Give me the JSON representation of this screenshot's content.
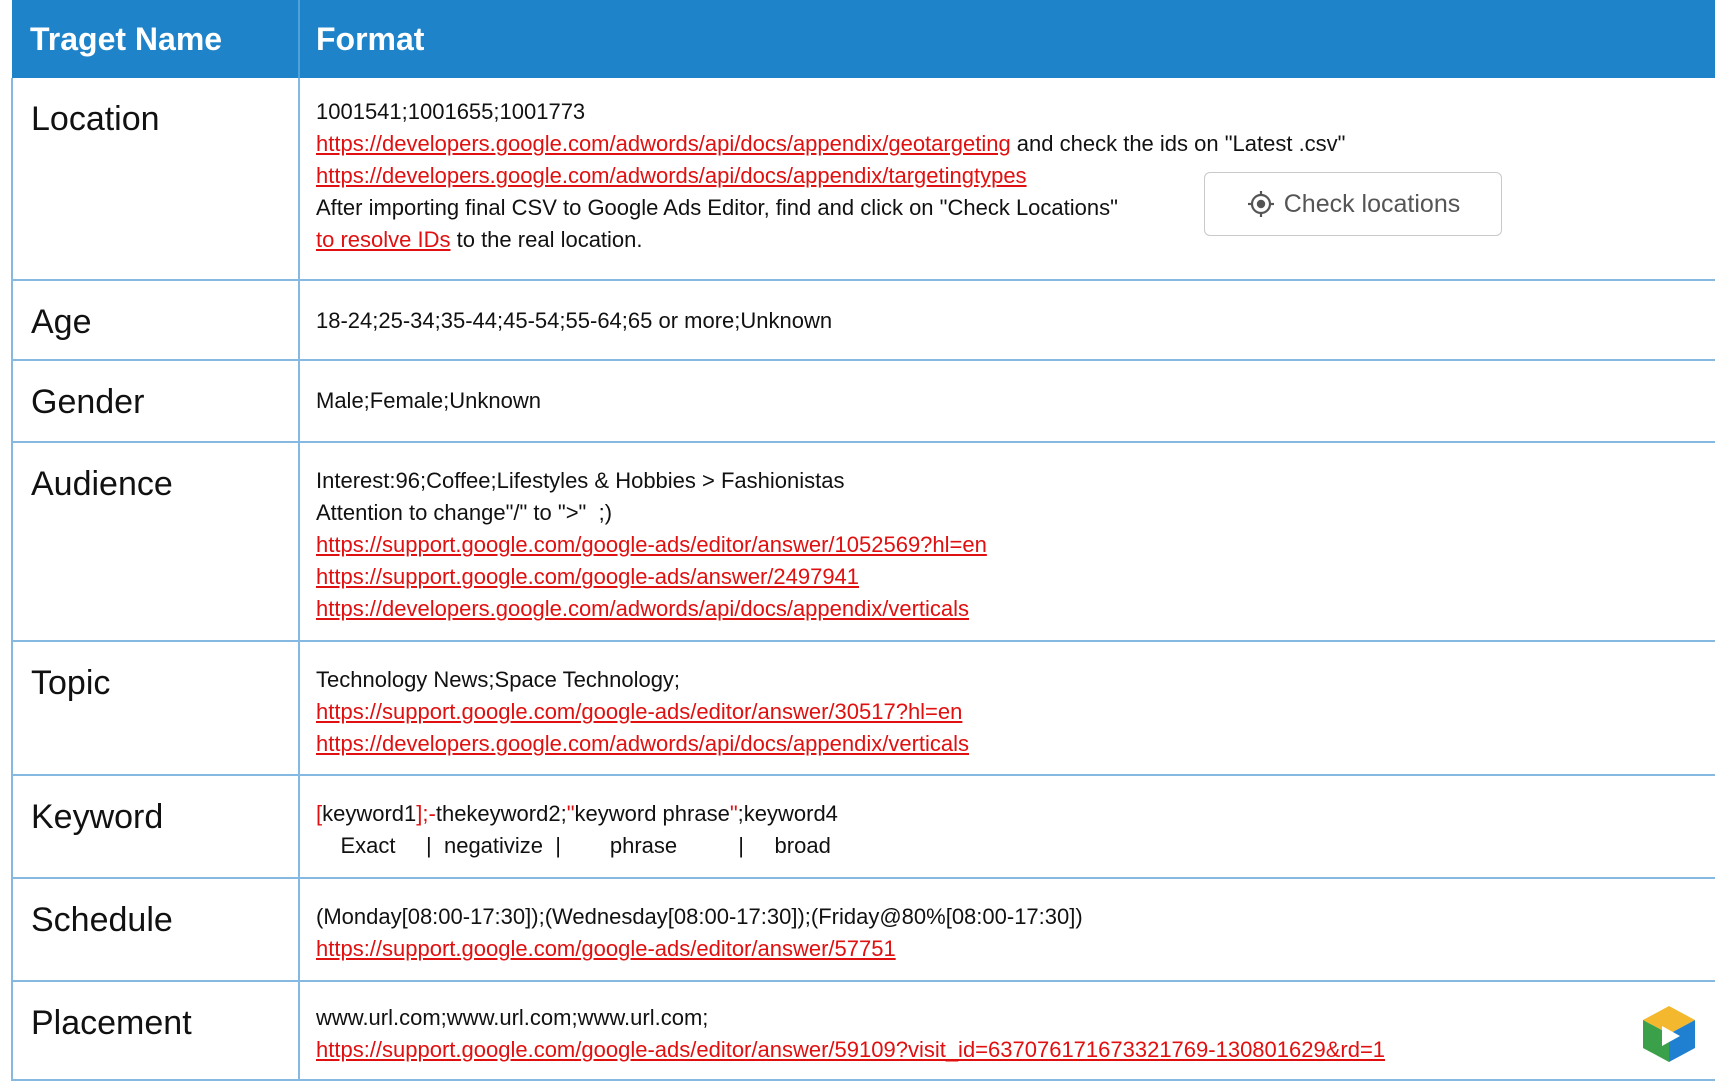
{
  "header": {
    "col_name": "Traget Name",
    "col_format": "Format"
  },
  "rows": {
    "location": {
      "name": "Location",
      "l1": "1001541;1001655;1001773",
      "l2_link": "https://developers.google.com/adwords/api/docs/appendix/geotargeting",
      "l2_text": " and check the ids on \"Latest .csv\"",
      "l3_link": "https://developers.google.com/adwords/api/docs/appendix/targetingtypes",
      "l4": "After importing final CSV to Google Ads Editor, find and click on \"Check Locations\"",
      "l5_link": "to resolve IDs",
      "l5_text": " to the real location."
    },
    "age": {
      "name": "Age",
      "l1": "18-24;25-34;35-44;45-54;55-64;65 or more;Unknown"
    },
    "gender": {
      "name": "Gender",
      "l1": "Male;Female;Unknown"
    },
    "audience": {
      "name": "Audience",
      "l1": "Interest:96;Coffee;Lifestyles & Hobbies > Fashionistas",
      "l2": "Attention to change\"/\" to \">\"  ;)",
      "l3_link": "https://support.google.com/google-ads/editor/answer/1052569?hl=en",
      "l4_link": "https://support.google.com/google-ads/answer/2497941",
      "l5_link": "https://developers.google.com/adwords/api/docs/appendix/verticals"
    },
    "topic": {
      "name": "Topic",
      "l1": "Technology News;Space Technology;",
      "l2_link": "https://support.google.com/google-ads/editor/answer/30517?hl=en",
      "l3_link": "https://developers.google.com/adwords/api/docs/appendix/verticals"
    },
    "keyword": {
      "name": "Keyword",
      "p1": "[",
      "p2": "keyword1",
      "p3": "];-",
      "p4": "thekeyword2;",
      "p5": "\"",
      "p6": "keyword phrase",
      "p7": "\"",
      "p8": ";keyword4",
      "l2": "    Exact     |  negativize  |        phrase          |     broad"
    },
    "schedule": {
      "name": "Schedule",
      "l1": "(Monday[08:00-17:30]);(Wednesday[08:00-17:30]);(Friday@80%[08:00-17:30])",
      "l2_link": "https://support.google.com/google-ads/editor/answer/57751"
    },
    "placement": {
      "name": "Placement",
      "l1": "www.url.com;www.url.com;www.url.com;",
      "l2_link": "https://support.google.com/google-ads/editor/answer/59109?visit_id=637076171673321769-130801629&rd=1"
    }
  },
  "check_button": {
    "label": "Check locations",
    "icon": "location-target-icon"
  },
  "colors": {
    "header_bg": "#1e83c9",
    "link": "#e01010",
    "border": "#86b9e2"
  },
  "logo": {
    "icon": "play-cube-logo-icon"
  }
}
